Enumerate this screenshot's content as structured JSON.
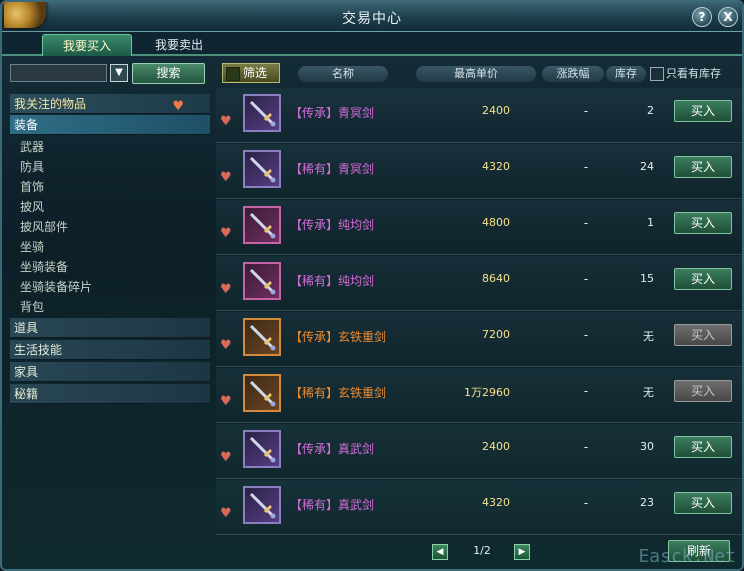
{
  "window": {
    "title": "交易中心",
    "help_label": "?",
    "close_label": "X"
  },
  "tabs": [
    {
      "label": "我要买入",
      "active": true
    },
    {
      "label": "我要卖出",
      "active": false
    }
  ],
  "search": {
    "placeholder": "",
    "dropdown_glyph": "▼",
    "button_label": "搜索"
  },
  "sidebar": {
    "favorites_label": "我关注的物品",
    "categories": [
      {
        "label": "装备",
        "selected": true
      },
      {
        "label": "道具"
      },
      {
        "label": "生活技能"
      },
      {
        "label": "家具"
      },
      {
        "label": "秘籍"
      }
    ],
    "equipment_sub": [
      "武器",
      "防具",
      "首饰",
      "披风",
      "披风部件",
      "坐骑",
      "坐骑装备",
      "坐骑装备碎片",
      "背包"
    ]
  },
  "table": {
    "filter_label": "筛选",
    "headers": {
      "name": "名称",
      "price": "最高单价",
      "change": "涨跌幅",
      "stock": "库存",
      "only_stock": "只看有库存"
    },
    "buy_label": "买入",
    "rows": [
      {
        "tag": "【传承】",
        "name": "青冥剑",
        "price": "2400",
        "change": "-",
        "stock": "2",
        "color": "purple",
        "buy_enabled": true,
        "icon": "sword-icon"
      },
      {
        "tag": "【稀有】",
        "name": "青冥剑",
        "price": "4320",
        "change": "-",
        "stock": "24",
        "color": "purple",
        "buy_enabled": true,
        "icon": "sword-icon"
      },
      {
        "tag": "【传承】",
        "name": "纯均剑",
        "price": "4800",
        "change": "-",
        "stock": "1",
        "color": "purple",
        "buy_enabled": true,
        "icon": "sword-icon"
      },
      {
        "tag": "【稀有】",
        "name": "纯均剑",
        "price": "8640",
        "change": "-",
        "stock": "15",
        "color": "purple",
        "buy_enabled": true,
        "icon": "sword-icon"
      },
      {
        "tag": "【传承】",
        "name": "玄铁重剑",
        "price": "7200",
        "change": "-",
        "stock": "无",
        "color": "orange",
        "buy_enabled": false,
        "icon": "heavy-sword-icon"
      },
      {
        "tag": "【稀有】",
        "name": "玄铁重剑",
        "price": "1万2960",
        "change": "-",
        "stock": "无",
        "color": "orange",
        "buy_enabled": false,
        "icon": "heavy-sword-icon"
      },
      {
        "tag": "【传承】",
        "name": "真武剑",
        "price": "2400",
        "change": "-",
        "stock": "30",
        "color": "purple",
        "buy_enabled": true,
        "icon": "sword-icon"
      },
      {
        "tag": "【稀有】",
        "name": "真武剑",
        "price": "4320",
        "change": "-",
        "stock": "23",
        "color": "purple",
        "buy_enabled": true,
        "icon": "sword-icon"
      }
    ]
  },
  "pager": {
    "page": "1/2",
    "prev_glyph": "◀",
    "next_glyph": "▶",
    "refresh_label": "刷新"
  },
  "watermark": "Easck.Net",
  "colors": {
    "purple": "#d46bd8",
    "orange": "#f08a2a",
    "price": "#f4e28a",
    "accent": "#3c7d5e"
  }
}
